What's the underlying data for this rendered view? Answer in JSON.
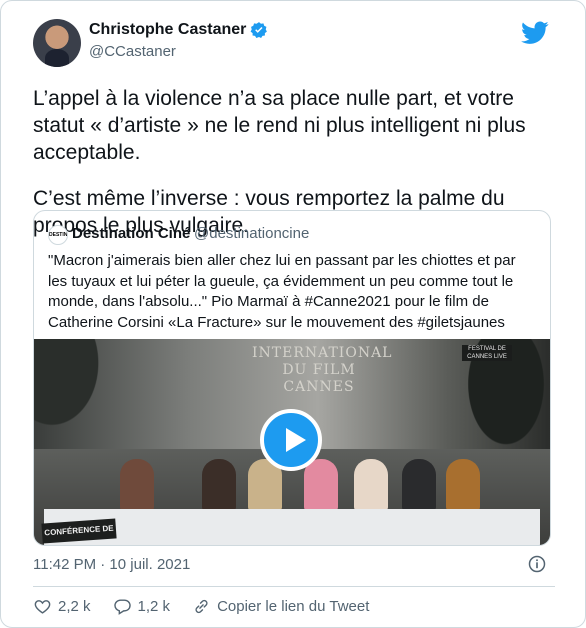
{
  "author": {
    "name": "Christophe Castaner",
    "handle": "@CCastaner"
  },
  "tweet": {
    "paragraphs": [
      "L’appel à la violence n’a sa place nulle part, et votre statut « d’artiste » ne le rend ni plus intelligent ni plus acceptable.",
      "C’est même l’inverse : vous remportez la palme du propos le plus vulgaire."
    ]
  },
  "quoted": {
    "avatar_text": "DESTINATION",
    "name": "Destination Ciné",
    "handle": "@destinationcine",
    "text": "\"Macron j'aimerais bien aller chez lui en passant par les chiottes et par les tuyaux et lui péter la gueule, ça évidemment un peu comme tout le monde, dans l'absolu...\" Pio Marmaï à #Canne2021 pour le film de Catherine Corsini «La Fracture» sur le mouvement des #giletsjaunes",
    "video": {
      "backdrop_title": "INTERNATIONAL DU FILM CANNES",
      "live_badge": "FESTIVAL DE CANNES LIVE",
      "banner": "CONFÉRENCE DE PRESSE"
    }
  },
  "timestamp": "11:42 PM · 10 juil. 2021",
  "actions": {
    "likes": "2,2 k",
    "replies": "1,2 k",
    "copy_link": "Copier le lien du Tweet"
  },
  "colors": {
    "accent": "#1d9bf0",
    "secondary_text": "#536471",
    "border": "#cfd9de"
  }
}
